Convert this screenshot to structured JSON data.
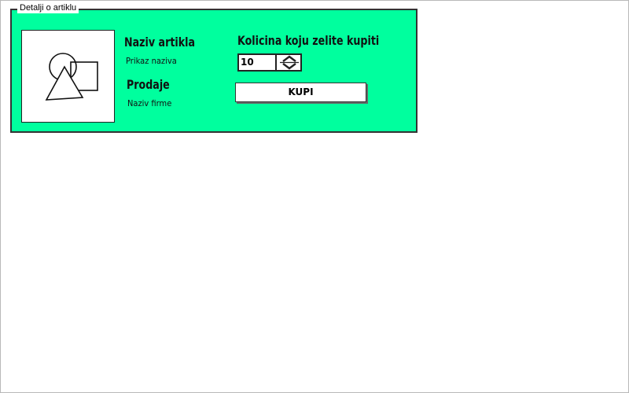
{
  "panel": {
    "legend": "Detalji o artiklu",
    "background": "#00ff9e"
  },
  "product": {
    "image_icon": "image-placeholder-icon",
    "name_heading": "Naziv artikla",
    "name_value": "Prikaz naziva",
    "seller_heading": "Prodaje",
    "seller_value": "Naziv firme"
  },
  "purchase": {
    "quantity_label": "Kolicina koju zelite kupiti",
    "quantity_value": "10",
    "stepper_icon": "up-down-arrows-icon",
    "buy_label": "KUPI"
  }
}
